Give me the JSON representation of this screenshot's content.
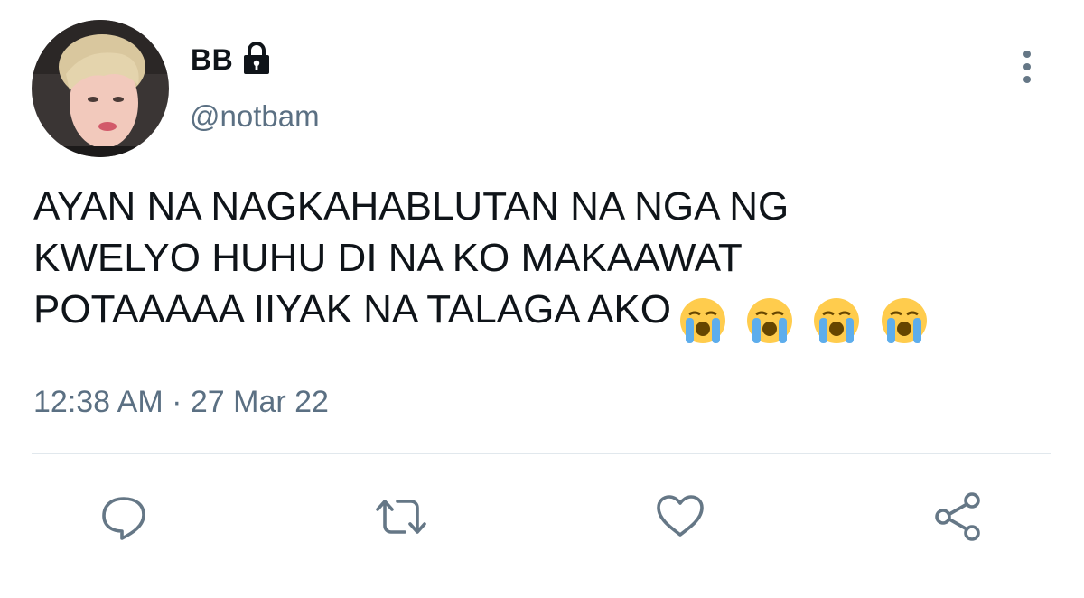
{
  "tweet": {
    "author": {
      "display_name": "BB",
      "handle": "@notbam",
      "protected_icon": "lock-icon",
      "avatar": "avatar-photo"
    },
    "text_lines": [
      "AYAN NA NAGKAHABLUTAN NA NGA NG",
      "KWELYO HUHU DI NA KO MAKAAWAT",
      "POTAAAAA IIYAK NA TALAGA AKO"
    ],
    "emojis": [
      "😭",
      "😭",
      "😭",
      "😭"
    ],
    "timestamp": "12:38 AM · 27 Mar 22",
    "more_icon": "more-vertical-icon"
  },
  "actions": [
    {
      "name": "reply-button",
      "icon": "reply-icon"
    },
    {
      "name": "retweet-button",
      "icon": "retweet-icon"
    },
    {
      "name": "like-button",
      "icon": "heart-icon"
    },
    {
      "name": "share-button",
      "icon": "share-icon"
    }
  ],
  "colors": {
    "text_primary": "#0f1419",
    "text_secondary": "#5b7083",
    "icon_gray": "#657786",
    "divider": "#e1e8ed"
  }
}
